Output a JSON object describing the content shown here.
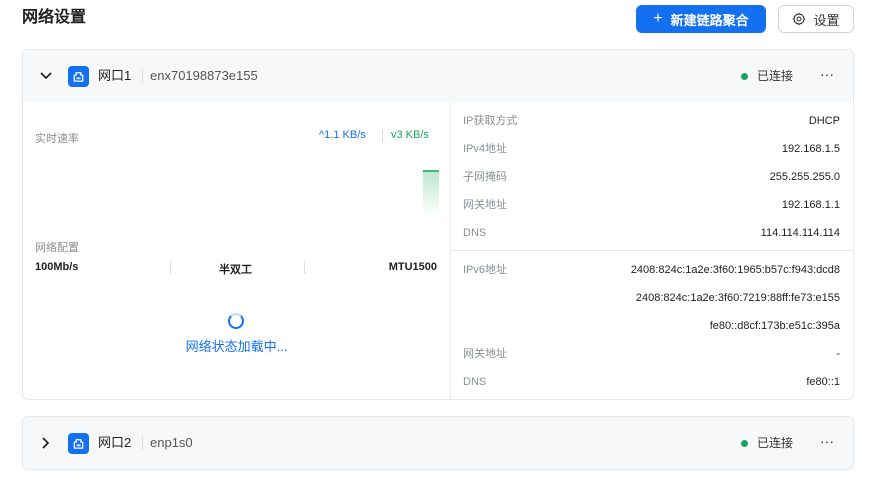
{
  "header": {
    "title": "网络设置",
    "new_bond_label": "新建链路聚合",
    "settings_label": "设置"
  },
  "ports": [
    {
      "name": "网口1",
      "device": "enx70198873e155",
      "status": "已连接",
      "expanded": true,
      "realtime": {
        "label": "实时速率",
        "up": "1.1 KB/s",
        "down": "3 KB/s"
      },
      "config": {
        "label": "网络配置",
        "speed": "100Mb/s",
        "duplex": "半双工",
        "mtu": "MTU1500"
      },
      "loading_text": "网络状态加载中...",
      "ipv4": [
        {
          "key": "IP获取方式",
          "value": "DHCP"
        },
        {
          "key": "IPv4地址",
          "value": "192.168.1.5"
        },
        {
          "key": "子网掩码",
          "value": "255.255.255.0"
        },
        {
          "key": "网关地址",
          "value": "192.168.1.1"
        },
        {
          "key": "DNS",
          "value": "114.114.114.114"
        }
      ],
      "ipv6": {
        "addr_label": "IPv6地址",
        "addresses": [
          "2408:824c:1a2e:3f60:1965:b57c:f943:dcd8",
          "2408:824c:1a2e:3f60:7219:88ff:fe73:e155",
          "fe80::d8cf:173b:e51c:395a"
        ],
        "gateway_label": "网关地址",
        "gateway": "-",
        "dns_label": "DNS",
        "dns": "fe80::1"
      }
    },
    {
      "name": "网口2",
      "device": "enp1s0",
      "status": "已连接",
      "expanded": false
    }
  ],
  "colors": {
    "primary": "#1370f0",
    "connected": "#1aa55a",
    "muted_text": "#8a8f96"
  },
  "icons": {
    "expand": "chevron-down-icon",
    "collapse": "chevron-right-icon",
    "port": "ethernet-port-icon",
    "more": "more-horizontal-icon",
    "settings": "gear-icon",
    "add": "plus-icon",
    "up": "arrow-up-icon",
    "down": "arrow-down-icon",
    "loading": "spinner-icon"
  }
}
